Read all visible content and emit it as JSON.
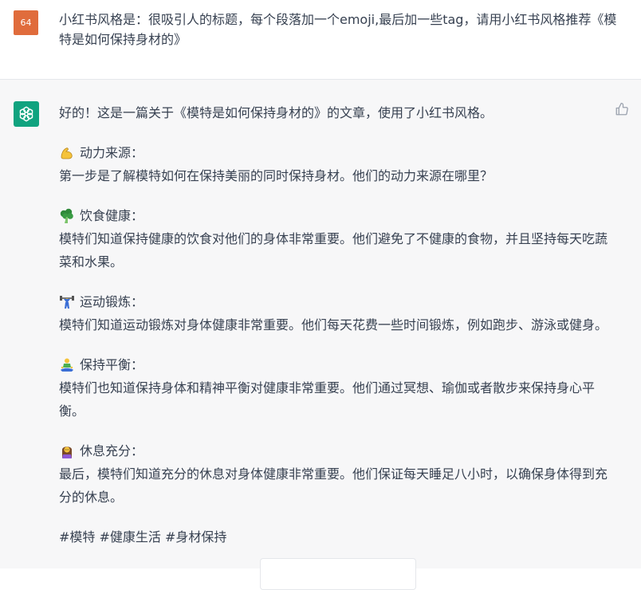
{
  "user_message": {
    "avatar_text": "64",
    "text": "小红书风格是：很吸引人的标题，每个段落加一个emoji,最后加一些tag，请用小红书风格推荐《模特是如何保持身材的》"
  },
  "assistant_message": {
    "intro": "好的！这是一篇关于《模特是如何保持身材的》的文章，使用了小红书风格。",
    "sections": [
      {
        "emoji": "flexed-biceps-icon",
        "title": "动力来源：",
        "body": "第一步是了解模特如何在保持美丽的同时保持身材。他们的动力来源在哪里？"
      },
      {
        "emoji": "broccoli-icon",
        "title": "饮食健康：",
        "body": "模特们知道保持健康的饮食对他们的身体非常重要。他们避免了不健康的食物，并且坚持每天吃蔬菜和水果。"
      },
      {
        "emoji": "weightlifter-icon",
        "title": "运动锻炼：",
        "body": "模特们知道运动锻炼对身体健康非常重要。他们每天花费一些时间锻炼，例如跑步、游泳或健身。"
      },
      {
        "emoji": "lotus-position-icon",
        "title": "保持平衡：",
        "body": "模特们也知道保持身体和精神平衡对健康非常重要。他们通过冥想、瑜伽或者散步来保持身心平衡。"
      },
      {
        "emoji": "sleeping-woman-icon",
        "title": "休息充分：",
        "body": "最后，模特们知道充分的休息对身体健康非常重要。他们保证每天睡足八小时，以确保身体得到充分的休息。"
      }
    ],
    "tags": "#模特 #健康生活 #身材保持"
  },
  "colors": {
    "user_avatar": "#e06c3c",
    "bot_avatar": "#10a37f",
    "assistant_bg": "#f7f7f8",
    "text": "#374151"
  }
}
